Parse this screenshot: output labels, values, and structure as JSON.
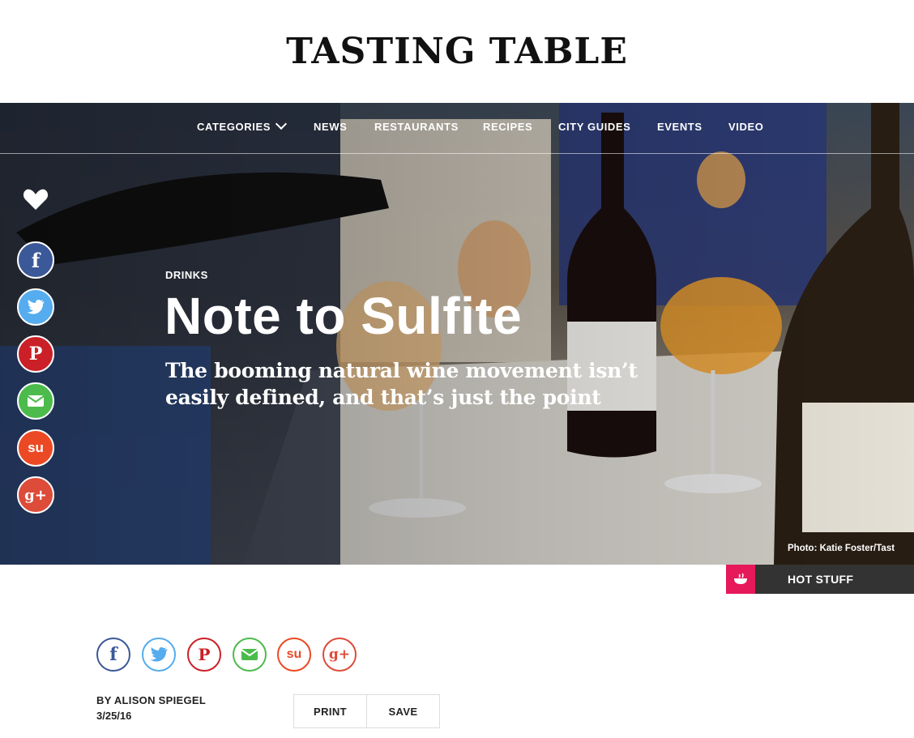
{
  "brand": {
    "logo_text": "TASTING TABLE"
  },
  "nav": {
    "items": [
      {
        "label": "CATEGORIES",
        "has_chevron": true
      },
      {
        "label": "NEWS"
      },
      {
        "label": "RESTAURANTS"
      },
      {
        "label": "RECIPES"
      },
      {
        "label": "CITY GUIDES"
      },
      {
        "label": "EVENTS"
      },
      {
        "label": "VIDEO"
      }
    ]
  },
  "hero": {
    "category": "DRINKS",
    "title": "Note to Sulfite",
    "subtitle": "The booming natural wine movement isn’t easily defined, and that’s just the point",
    "photo_credit": "Photo: Katie Foster/Tast"
  },
  "side_social": [
    {
      "icon": "facebook-icon",
      "glyph": "f",
      "color": "#3b5998"
    },
    {
      "icon": "twitter-icon",
      "glyph": "t",
      "color": "#55acee"
    },
    {
      "icon": "pinterest-icon",
      "glyph": "P",
      "color": "#cb2027"
    },
    {
      "icon": "email-icon",
      "glyph": "✉",
      "color": "#4cbb4c"
    },
    {
      "icon": "stumbleupon-icon",
      "glyph": "su",
      "color": "#eb4924"
    },
    {
      "icon": "googleplus-icon",
      "glyph": "g+",
      "color": "#dd4b39"
    }
  ],
  "hot_stuff": {
    "label": "HOT STUFF",
    "accent": "#e6195a"
  },
  "article": {
    "byline": "BY ALISON SPIEGEL",
    "date": "3/25/16",
    "print_label": "PRINT",
    "save_label": "SAVE"
  },
  "share_row": [
    {
      "icon": "facebook-icon",
      "glyph": "f",
      "color": "#3b5998"
    },
    {
      "icon": "twitter-icon",
      "glyph": "t",
      "color": "#55acee"
    },
    {
      "icon": "pinterest-icon",
      "glyph": "P",
      "color": "#cb2027"
    },
    {
      "icon": "email-icon",
      "glyph": "✉",
      "color": "#4cbb4c"
    },
    {
      "icon": "stumbleupon-icon",
      "glyph": "su",
      "color": "#eb4924"
    },
    {
      "icon": "googleplus-icon",
      "glyph": "g+",
      "color": "#dd4b39"
    }
  ]
}
